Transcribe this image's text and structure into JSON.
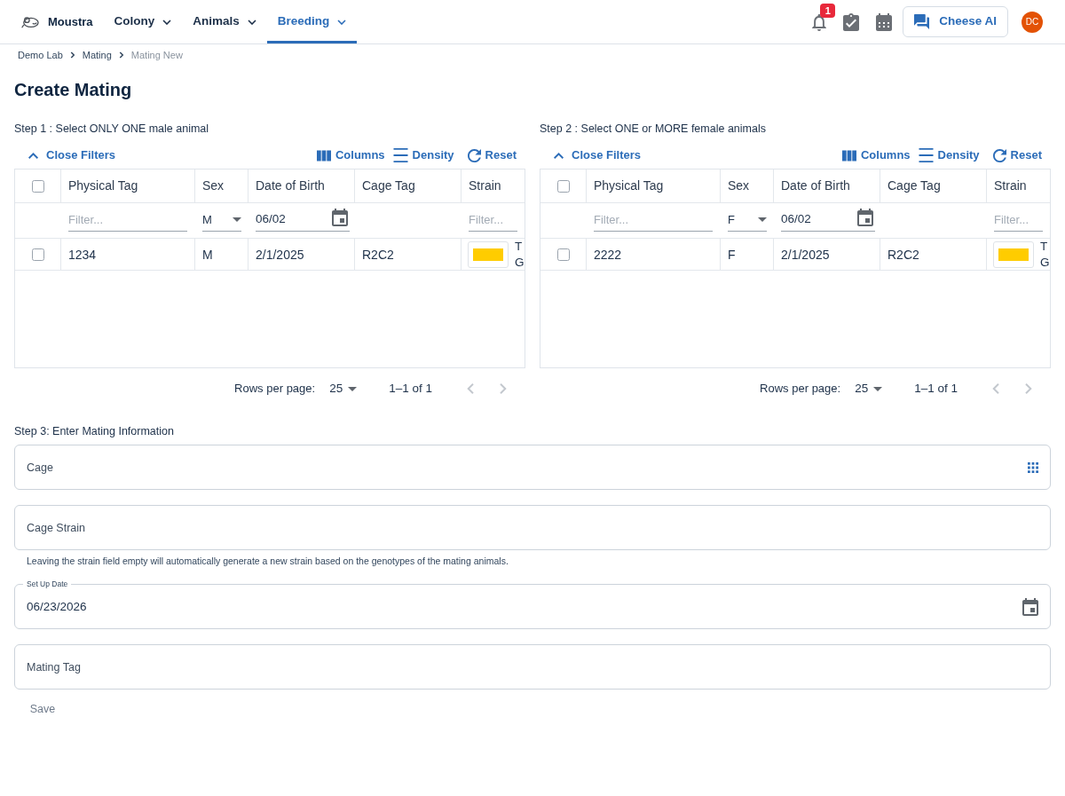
{
  "app": {
    "name": "Moustra"
  },
  "nav": [
    {
      "label": "Colony",
      "selected": false
    },
    {
      "label": "Animals",
      "selected": false
    },
    {
      "label": "Breeding",
      "selected": true
    }
  ],
  "header_actions": {
    "notification_count": "1",
    "assistant_button": "Cheese AI",
    "avatar_initials": "DC"
  },
  "breadcrumb": [
    {
      "label": "Demo Lab"
    },
    {
      "label": "Mating"
    },
    {
      "label": "Mating New"
    }
  ],
  "page_title": "Create Mating",
  "selection_steps": [
    {
      "title": "Step 1 : Select ONLY ONE male animal",
      "toolbar": [
        {
          "kind": "filters",
          "label": "Close Filters"
        },
        {
          "kind": "columns",
          "label": "Columns"
        },
        {
          "kind": "density",
          "label": "Density"
        },
        {
          "kind": "reset",
          "label": "Reset"
        }
      ],
      "table": {
        "select_all_checked": false,
        "columns": [
          {
            "label": "Physical Tag",
            "filter": {
              "kind": "text",
              "placeholder": "Filter..."
            }
          },
          {
            "label": "Sex",
            "filter": {
              "kind": "select",
              "value": "M"
            }
          },
          {
            "label": "Date of Birth",
            "filter": {
              "kind": "date",
              "value": "06/02"
            }
          },
          {
            "label": "Cage Tag"
          },
          {
            "label": "Strain",
            "filter": {
              "kind": "text",
              "placeholder": "Filter..."
            }
          }
        ],
        "rows": [
          {
            "checked": false,
            "cells": [
              "1234",
              "M",
              "2/1/2025",
              "R2C2"
            ],
            "strain": {
              "color": "#ffcc00",
              "name": "T G"
            }
          }
        ]
      },
      "pagination": {
        "rows_per_page_label": "Rows per page:",
        "rows_per_page": "25",
        "range": "1–1 of 1",
        "prev_disabled": true,
        "next_disabled": true
      }
    },
    {
      "title": "Step 2 : Select ONE or MORE female animals",
      "toolbar": [
        {
          "kind": "filters",
          "label": "Close Filters"
        },
        {
          "kind": "columns",
          "label": "Columns"
        },
        {
          "kind": "density",
          "label": "Density"
        },
        {
          "kind": "reset",
          "label": "Reset"
        }
      ],
      "table": {
        "select_all_checked": false,
        "columns": [
          {
            "label": "Physical Tag",
            "filter": {
              "kind": "text",
              "placeholder": "Filter..."
            }
          },
          {
            "label": "Sex",
            "filter": {
              "kind": "select",
              "value": "F"
            }
          },
          {
            "label": "Date of Birth",
            "filter": {
              "kind": "date",
              "value": "06/02"
            }
          },
          {
            "label": "Cage Tag"
          },
          {
            "label": "Strain",
            "filter": {
              "kind": "text",
              "placeholder": "Filter..."
            }
          }
        ],
        "rows": [
          {
            "checked": false,
            "cells": [
              "2222",
              "F",
              "2/1/2025",
              "R2C2"
            ],
            "strain": {
              "color": "#ffcc00",
              "name": "T G"
            }
          }
        ]
      },
      "pagination": {
        "rows_per_page_label": "Rows per page:",
        "rows_per_page": "25",
        "range": "1–1 of 1",
        "prev_disabled": true,
        "next_disabled": true
      }
    }
  ],
  "mating_form": {
    "title": "Step 3: Enter Mating Information",
    "fields": [
      {
        "kind": "picker",
        "placeholder": "Cage"
      },
      {
        "kind": "text",
        "placeholder": "Cage Strain",
        "helper": "Leaving the strain field empty will automatically generate a new strain based on the genotypes of the mating animals."
      },
      {
        "kind": "date",
        "label": "Set Up Date",
        "value": "06/23/2026"
      },
      {
        "kind": "text",
        "placeholder": "Mating Tag"
      }
    ],
    "save_button": {
      "label": "Save",
      "disabled": true
    }
  }
}
